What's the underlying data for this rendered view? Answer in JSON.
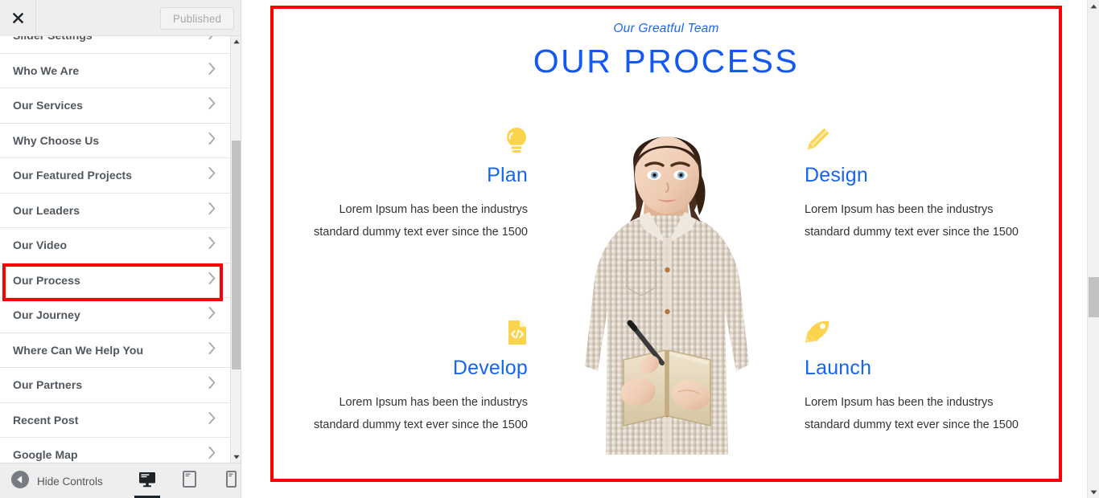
{
  "customizer": {
    "close_icon": "close-x-icon",
    "publish_button_label": "Published",
    "panel_items": [
      {
        "label": "Slider Settings",
        "icon": "chevron-right-icon",
        "partial": true
      },
      {
        "label": "Who We Are",
        "icon": "chevron-right-icon"
      },
      {
        "label": "Our Services",
        "icon": "chevron-right-icon"
      },
      {
        "label": "Why Choose Us",
        "icon": "chevron-right-icon"
      },
      {
        "label": "Our Featured Projects",
        "icon": "chevron-right-icon"
      },
      {
        "label": "Our Leaders",
        "icon": "chevron-right-icon"
      },
      {
        "label": "Our Video",
        "icon": "chevron-right-icon"
      },
      {
        "label": "Our Process",
        "icon": "chevron-right-icon",
        "highlighted": true
      },
      {
        "label": "Our Journey",
        "icon": "chevron-right-icon"
      },
      {
        "label": "Where Can We Help You",
        "icon": "chevron-right-icon"
      },
      {
        "label": "Our Partners",
        "icon": "chevron-right-icon"
      },
      {
        "label": "Recent Post",
        "icon": "chevron-right-icon"
      },
      {
        "label": "Google Map",
        "icon": "chevron-right-icon",
        "partial": true
      }
    ],
    "footer": {
      "hide_controls_label": "Hide Controls",
      "hide_controls_icon": "collapse-left-circle-icon",
      "devices": [
        {
          "name": "desktop",
          "icon": "desktop-icon",
          "active": true
        },
        {
          "name": "tablet",
          "icon": "tablet-icon",
          "active": false
        },
        {
          "name": "mobile",
          "icon": "mobile-icon",
          "active": false
        }
      ]
    }
  },
  "preview": {
    "subtitle": "Our Greatful Team",
    "title": "OUR PROCESS",
    "center_image_alt": "woman-with-notebook-photo",
    "features": [
      {
        "key": "plan",
        "title": "Plan",
        "icon": "lightbulb-icon",
        "desc_line1": "Lorem Ipsum has been the industrys",
        "desc_line2": "standard dummy text ever since the 1500"
      },
      {
        "key": "design",
        "title": "Design",
        "icon": "pencil-icon",
        "desc_line1": "Lorem Ipsum has been the industrys",
        "desc_line2": "standard dummy text ever since the 1500"
      },
      {
        "key": "develop",
        "title": "Develop",
        "icon": "code-file-icon",
        "desc_line1": "Lorem Ipsum has been the industrys",
        "desc_line2": "standard dummy text ever since the 1500"
      },
      {
        "key": "launch",
        "title": "Launch",
        "icon": "rocket-icon",
        "desc_line1": "Lorem Ipsum has been the industrys",
        "desc_line2": "standard dummy text ever since the 1500"
      }
    ]
  },
  "colors": {
    "accent_blue": "#1565f0",
    "icon_yellow": "#fcd34d",
    "highlight_red": "#fa0000",
    "sidebar_bg": "#eeeeee",
    "text_dark": "#50575e"
  }
}
